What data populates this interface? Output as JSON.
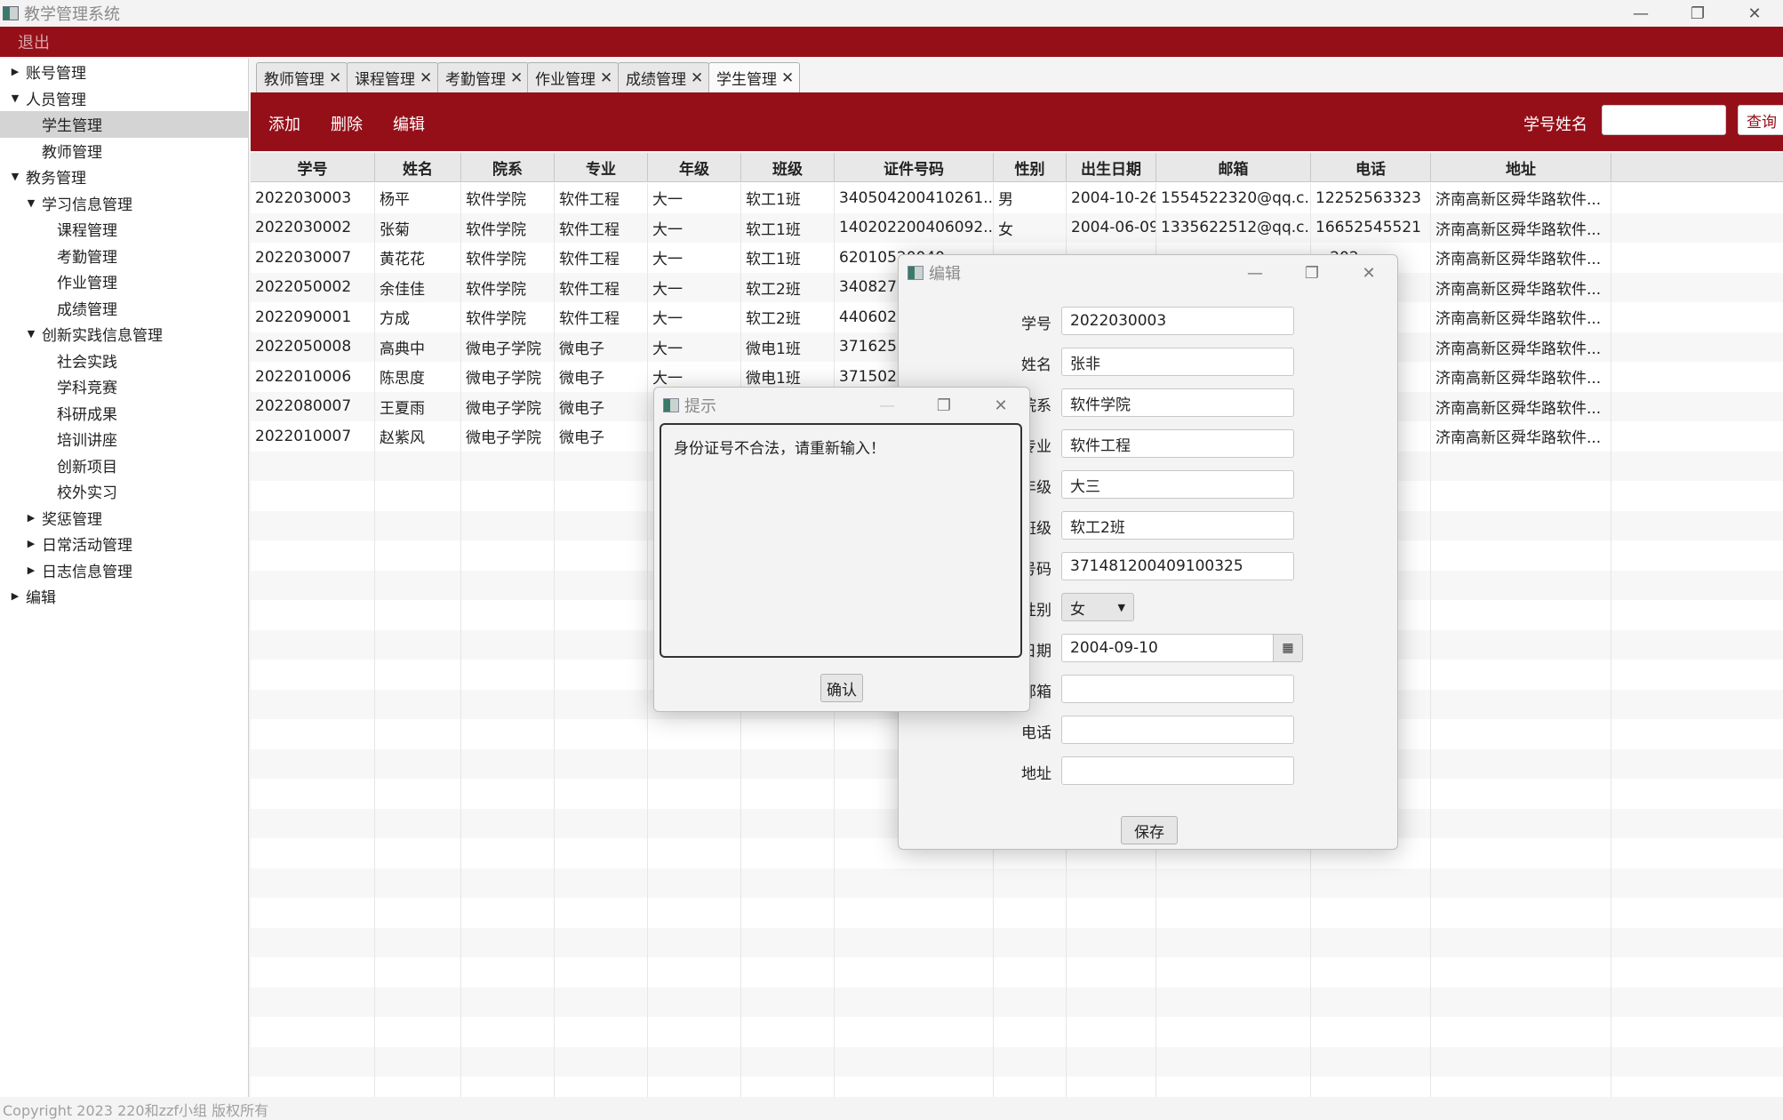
{
  "window": {
    "title": "教学管理系统",
    "minimize": "—",
    "maximize": "❐",
    "close": "✕"
  },
  "menubar": {
    "logout": "退出"
  },
  "sidebar": {
    "items": [
      {
        "label": "账号管理",
        "indent": 0,
        "arrow": "▶"
      },
      {
        "label": "人员管理",
        "indent": 0,
        "arrow": "▼"
      },
      {
        "label": "学生管理",
        "indent": 1,
        "arrow": "",
        "selected": true
      },
      {
        "label": "教师管理",
        "indent": 1,
        "arrow": ""
      },
      {
        "label": "教务管理",
        "indent": 0,
        "arrow": "▼"
      },
      {
        "label": "学习信息管理",
        "indent": 1,
        "arrow": "▼"
      },
      {
        "label": "课程管理",
        "indent": 2,
        "arrow": ""
      },
      {
        "label": "考勤管理",
        "indent": 2,
        "arrow": ""
      },
      {
        "label": "作业管理",
        "indent": 2,
        "arrow": ""
      },
      {
        "label": "成绩管理",
        "indent": 2,
        "arrow": ""
      },
      {
        "label": "创新实践信息管理",
        "indent": 1,
        "arrow": "▼"
      },
      {
        "label": "社会实践",
        "indent": 2,
        "arrow": ""
      },
      {
        "label": "学科竞赛",
        "indent": 2,
        "arrow": ""
      },
      {
        "label": "科研成果",
        "indent": 2,
        "arrow": ""
      },
      {
        "label": "培训讲座",
        "indent": 2,
        "arrow": ""
      },
      {
        "label": "创新项目",
        "indent": 2,
        "arrow": ""
      },
      {
        "label": "校外实习",
        "indent": 2,
        "arrow": ""
      },
      {
        "label": "奖惩管理",
        "indent": 1,
        "arrow": "▶"
      },
      {
        "label": "日常活动管理",
        "indent": 1,
        "arrow": "▶"
      },
      {
        "label": "日志信息管理",
        "indent": 1,
        "arrow": "▶"
      },
      {
        "label": "编辑",
        "indent": 0,
        "arrow": "▶"
      }
    ]
  },
  "tabs": [
    {
      "label": "教师管理"
    },
    {
      "label": "课程管理"
    },
    {
      "label": "考勤管理"
    },
    {
      "label": "作业管理"
    },
    {
      "label": "成绩管理"
    },
    {
      "label": "学生管理",
      "active": true
    }
  ],
  "tab_close": "✕",
  "toolbar": {
    "add": "添加",
    "delete": "删除",
    "edit": "编辑",
    "search_label": "学号姓名",
    "search_value": "",
    "query": "查询"
  },
  "table": {
    "columns": [
      "学号",
      "姓名",
      "院系",
      "专业",
      "年级",
      "班级",
      "证件号码",
      "性别",
      "出生日期",
      "邮箱",
      "电话",
      "地址"
    ],
    "rows": [
      [
        "2022030003",
        "杨平",
        "软件学院",
        "软件工程",
        "大一",
        "软工1班",
        "340504200410261...",
        "男",
        "2004-10-26",
        "1554522320@qq.c...",
        "12252563323",
        "济南高新区舜华路软件..."
      ],
      [
        "2022030002",
        "张菊",
        "软件学院",
        "软件工程",
        "大一",
        "软工1班",
        "140202200406092...",
        "女",
        "2004-06-09",
        "1335622512@qq.c...",
        "16652545521",
        "济南高新区舜华路软件..."
      ],
      [
        "2022030007",
        "黄花花",
        "软件学院",
        "软件工程",
        "大一",
        "软工1班",
        "62010520040..",
        "",
        "",
        "",
        "...202",
        "济南高新区舜华路软件..."
      ],
      [
        "2022050002",
        "余佳佳",
        "软件学院",
        "软件工程",
        "大一",
        "软工2班",
        "3408272...",
        "",
        "",
        "",
        "...23",
        "济南高新区舜华路软件..."
      ],
      [
        "2022090001",
        "方成",
        "软件学院",
        "软件工程",
        "大一",
        "软工2班",
        "4406022...",
        "",
        "",
        "",
        "...26",
        "济南高新区舜华路软件..."
      ],
      [
        "2022050008",
        "高典中",
        "微电子学院",
        "微电子",
        "大一",
        "微电1班",
        "3716252...",
        "",
        "",
        "",
        "...25",
        "济南高新区舜华路软件..."
      ],
      [
        "2022010006",
        "陈思度",
        "微电子学院",
        "微电子",
        "大一",
        "微电1班",
        "3715022...",
        "",
        "",
        "",
        "...25",
        "济南高新区舜华路软件..."
      ],
      [
        "2022080007",
        "王夏雨",
        "微电子学院",
        "微电子",
        "",
        "",
        "",
        "",
        "",
        "",
        "...02",
        "济南高新区舜华路软件..."
      ],
      [
        "2022010007",
        "赵紫风",
        "微电子学院",
        "微电子",
        "",
        "",
        "",
        "",
        "",
        "",
        "...23",
        "济南高新区舜华路软件..."
      ]
    ]
  },
  "edit_dialog": {
    "title": "编辑",
    "fields": [
      {
        "label": "学号",
        "value": "2022030003"
      },
      {
        "label": "姓名",
        "value": "张非"
      },
      {
        "label": "院系",
        "value": "软件学院"
      },
      {
        "label": "专业",
        "value": "软件工程"
      },
      {
        "label": "年级",
        "value": "大三"
      },
      {
        "label": "班级",
        "value": "软工2班"
      },
      {
        "label": "证件号码",
        "value": "371481200409100325"
      },
      {
        "label": "性别",
        "value": "女"
      },
      {
        "label": "出生日期",
        "value": "2004-09-10"
      },
      {
        "label": "邮箱",
        "value": ""
      },
      {
        "label": "电话",
        "value": ""
      },
      {
        "label": "地址",
        "value": ""
      }
    ],
    "save": "保存"
  },
  "alert_dialog": {
    "title": "提示",
    "message": "身份证号不合法，请重新输入！",
    "confirm": "确认"
  },
  "footer": {
    "copyright": "Copyright 2023 220和zzf小组 版权所有"
  },
  "colors": {
    "brand": "#950f19"
  },
  "icons": {
    "calendar": "calendar-icon",
    "dropdown": "chevron-down-icon"
  }
}
